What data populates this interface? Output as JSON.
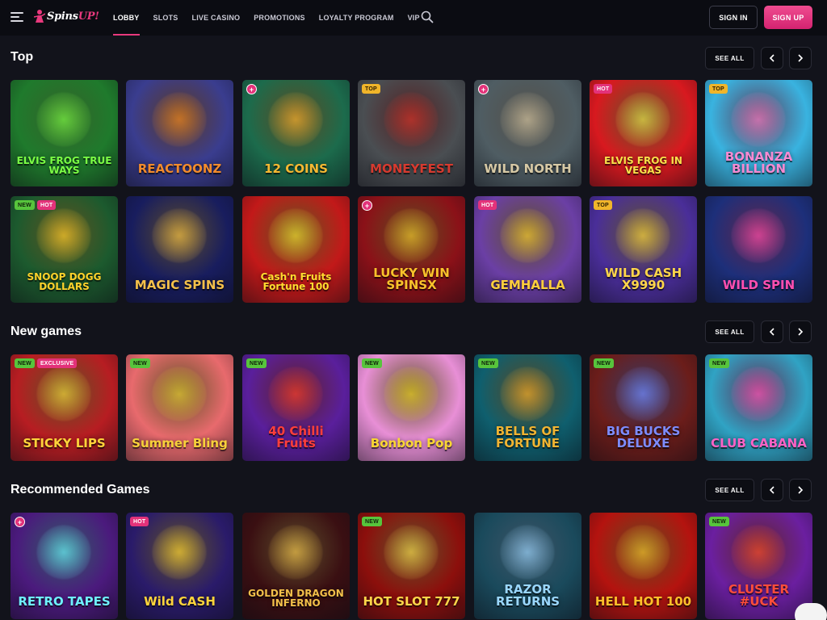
{
  "header": {
    "logo": {
      "text_a": "Spins",
      "text_b": "UP!"
    },
    "nav": [
      {
        "label": "LOBBY",
        "active": true
      },
      {
        "label": "SLOTS",
        "active": false
      },
      {
        "label": "LIVE CASINO",
        "active": false
      },
      {
        "label": "PROMOTIONS",
        "active": false
      },
      {
        "label": "LOYALTY PROGRAM",
        "active": false
      },
      {
        "label": "VIP",
        "active": false
      }
    ],
    "signin_label": "SIGN IN",
    "signup_label": "SIGN UP"
  },
  "sections": [
    {
      "title": "Top",
      "see_all": "SEE ALL",
      "games": [
        {
          "name": "ELVIS FROG TRUE WAYS",
          "bg": "#1f7a2c",
          "accent": "#7bff45",
          "badges": []
        },
        {
          "name": "REACTOONZ",
          "bg": "#3a3d8f",
          "accent": "#f28b2c",
          "badges": []
        },
        {
          "name": "12 COINS",
          "bg": "#1c6b4c",
          "accent": "#f6b832",
          "badges": [],
          "plus": true
        },
        {
          "name": "MONEYFEST",
          "bg": "#4a4e52",
          "accent": "#d63a2f",
          "badges": [
            "TOP"
          ]
        },
        {
          "name": "WILD NORTH",
          "bg": "#4f5d63",
          "accent": "#d7c9a5",
          "badges": [],
          "plus": true
        },
        {
          "name": "ELVIS FROG IN VEGAS",
          "bg": "#d8191f",
          "accent": "#f8e14a",
          "badges": [
            "HOT"
          ]
        },
        {
          "name": "BONANZA BILLION",
          "bg": "#39b3e0",
          "accent": "#f58ad2",
          "badges": [
            "TOP"
          ]
        },
        {
          "name": "SNOOP DOGG DOLLARS",
          "bg": "#1c5a2e",
          "accent": "#ffd22b",
          "badges": [
            "NEW",
            "HOT"
          ]
        },
        {
          "name": "MAGIC SPINS",
          "bg": "#181d5e",
          "accent": "#f4c04a",
          "badges": []
        },
        {
          "name": "Cash'n Fruits Fortune 100",
          "bg": "#c21919",
          "accent": "#ffdd2f",
          "badges": []
        },
        {
          "name": "LUCKY WIN SPINSX",
          "bg": "#8b1118",
          "accent": "#f8c22b",
          "badges": [],
          "plus": true
        },
        {
          "name": "GEMHALLA",
          "bg": "#6b3fa5",
          "accent": "#ffcf3c",
          "badges": [
            "HOT"
          ]
        },
        {
          "name": "WILD CASH X9990",
          "bg": "#4a2e99",
          "accent": "#ffd64a",
          "badges": [
            "TOP"
          ]
        },
        {
          "name": "WILD SPIN",
          "bg": "#1d2f7a",
          "accent": "#ff4fb1",
          "badges": []
        }
      ]
    },
    {
      "title": "New games",
      "see_all": "SEE ALL",
      "games": [
        {
          "name": "STICKY LIPS",
          "bg": "#b71d22",
          "accent": "#ffd33a",
          "badges": [
            "NEW",
            "EXCLUSIVE"
          ]
        },
        {
          "name": "Summer Bling",
          "bg": "#e86a6d",
          "accent": "#f7d13a",
          "badges": [
            "NEW"
          ]
        },
        {
          "name": "40 Chilli Fruits",
          "bg": "#5a1f9c",
          "accent": "#ff3f3a",
          "badges": [
            "NEW"
          ]
        },
        {
          "name": "Bonbon Pop",
          "bg": "#e88fd6",
          "accent": "#f9d732",
          "badges": [
            "NEW"
          ]
        },
        {
          "name": "BELLS OF FORTUNE",
          "bg": "#0f5f6e",
          "accent": "#f1b432",
          "badges": [
            "NEW"
          ]
        },
        {
          "name": "BIG BUCKS DELUXE",
          "bg": "#6b1d1a",
          "accent": "#7d8cff",
          "badges": [
            "NEW"
          ]
        },
        {
          "name": "CLUB CABANA",
          "bg": "#30a3c4",
          "accent": "#ff63c6",
          "badges": [
            "NEW"
          ]
        }
      ]
    },
    {
      "title": "Recommended Games",
      "see_all": "SEE ALL",
      "games": [
        {
          "name": "RETRO TAPES",
          "bg": "#4b1a7d",
          "accent": "#6ff0ff",
          "badges": [],
          "plus": true
        },
        {
          "name": "Wild CASH",
          "bg": "#2a1b6a",
          "accent": "#ffd43b",
          "badges": [
            "HOT"
          ]
        },
        {
          "name": "GOLDEN DRAGON INFERNO",
          "bg": "#3a0f12",
          "accent": "#f2c04a",
          "badges": []
        },
        {
          "name": "HOT SLOT 777",
          "bg": "#8c0f0c",
          "accent": "#ffd64a",
          "badges": [
            "NEW"
          ]
        },
        {
          "name": "RAZOR RETURNS",
          "bg": "#1a4a5c",
          "accent": "#9ad7ff",
          "badges": []
        },
        {
          "name": "HELL HOT 100",
          "bg": "#b4130f",
          "accent": "#ffbf2a",
          "badges": []
        },
        {
          "name": "CLUSTER #UCK",
          "bg": "#6b1fa0",
          "accent": "#ff4d3a",
          "badges": [
            "NEW"
          ]
        }
      ]
    }
  ]
}
